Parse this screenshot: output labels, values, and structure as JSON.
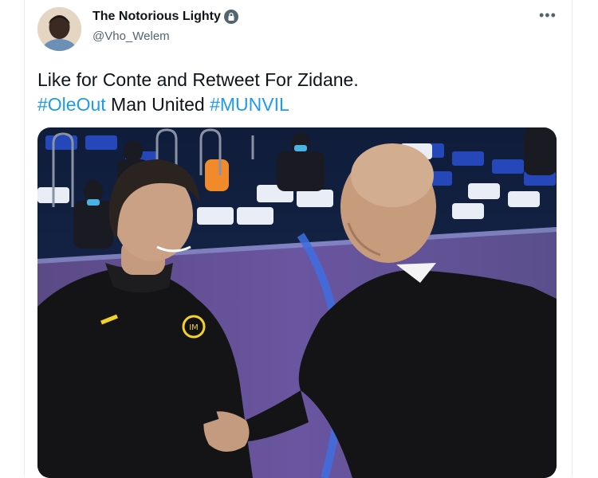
{
  "tweet": {
    "display_name": "The Notorious Lighty",
    "handle": "@Vho_Welem",
    "more_label": "•••",
    "text_line1": "Like for Conte and Retweet For Zidane.",
    "hashtag1": "#OleOut",
    "text_middle": " Man United ",
    "hashtag2": "#MUNVIL"
  },
  "colors": {
    "hashtag": "#1d9bf0",
    "handle": "#536471",
    "badge": "#536471"
  },
  "icons": {
    "verified": "verified-badge-icon",
    "more": "more-options-icon"
  }
}
